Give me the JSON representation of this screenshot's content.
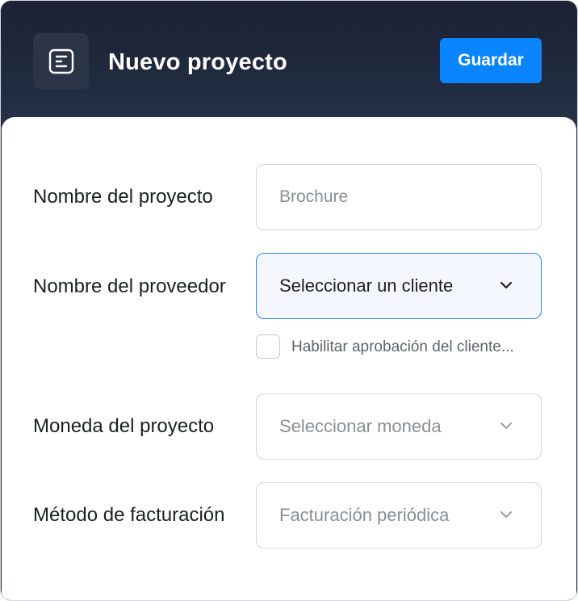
{
  "header": {
    "icon": "document-list-icon",
    "title": "Nuevo proyecto",
    "save_label": "Guardar"
  },
  "form": {
    "project_name": {
      "label": "Nombre del proyecto",
      "placeholder": "Brochure"
    },
    "provider_name": {
      "label": "Nombre del proveedor",
      "selected": "Seleccionar un cliente"
    },
    "client_approval": {
      "label": "Habilitar aprobación del cliente...",
      "checked": false
    },
    "currency": {
      "label": "Moneda del proyecto",
      "selected": "Seleccionar moneda"
    },
    "billing_method": {
      "label": "Método de facturación",
      "selected": "Facturación periódica"
    }
  },
  "colors": {
    "header_bg": "#1b2436",
    "accent": "#0a84ff",
    "active_border": "#2e86f5"
  }
}
